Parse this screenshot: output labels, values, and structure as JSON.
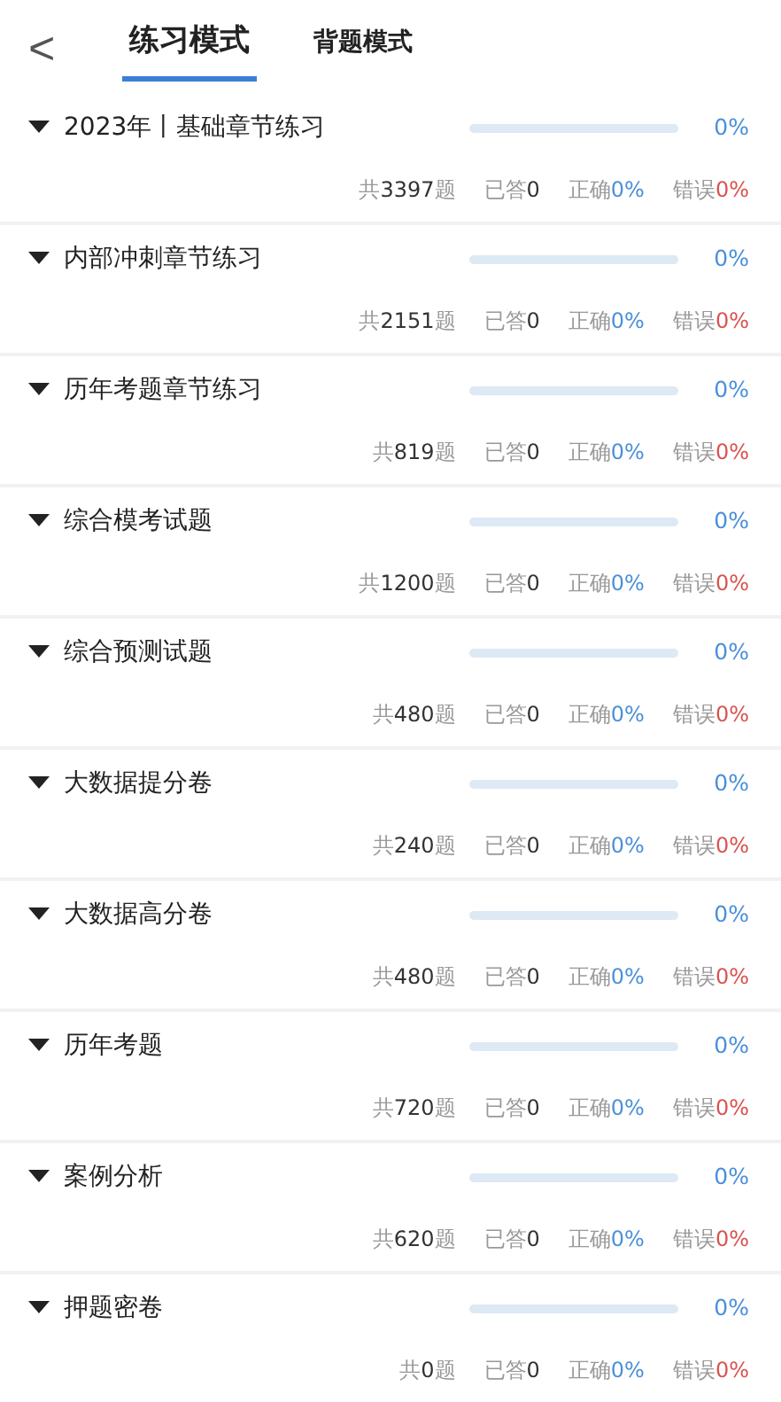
{
  "header": {
    "back": "<",
    "tabs": [
      {
        "label": "练习模式",
        "selected": true
      },
      {
        "label": "背题模式",
        "selected": false
      }
    ]
  },
  "sections": [
    {
      "title": "2023年丨基础章节练习",
      "expanded": true,
      "percent": "0%",
      "total": "共**3397**题",
      "answered": "已答**0**",
      "correct_label": "正确",
      "correct": "0%",
      "wrong_label": "错误",
      "wrong": "0%"
    },
    {
      "title": "内部冲刺章节练习",
      "expanded": true,
      "percent": "0%",
      "total": "共**2151**题",
      "answered": "已答**0**",
      "correct_label": "正确",
      "correct": "0%",
      "wrong_label": "错误",
      "wrong": "0%"
    },
    {
      "title": "历年考题章节练习",
      "expanded": true,
      "percent": "0%",
      "total": "共**819**题",
      "answered": "已答**0**",
      "correct_label": "正确",
      "correct": "0%",
      "wrong_label": "错误",
      "wrong": "0%"
    },
    {
      "title": "综合模考试题",
      "expanded": true,
      "percent": "0%",
      "total": "共**1200**题",
      "answered": "已答**0**",
      "correct_label": "正确",
      "correct": "0%",
      "wrong_label": "错误",
      "wrong": "0%"
    },
    {
      "title": "综合预测试题",
      "expanded": true,
      "percent": "0%",
      "total": "共**480**题",
      "answered": "已答**0**",
      "correct_label": "正确",
      "correct": "0%",
      "wrong_label": "错误",
      "wrong": "0%"
    },
    {
      "title": "大数据提分卷",
      "expanded": true,
      "percent": "0%",
      "total": "共**240**题",
      "answered": "已答**0**",
      "correct_label": "正确",
      "correct": "0%",
      "wrong_label": "错误",
      "wrong": "0%"
    },
    {
      "title": "大数据高分卷",
      "expanded": true,
      "percent": "0%",
      "total": "共**480**题",
      "answered": "已答**0**",
      "correct_label": "正确",
      "correct": "0%",
      "wrong_label": "错误",
      "wrong": "0%"
    },
    {
      "title": "历年考题",
      "expanded": true,
      "percent": "0%",
      "total": "共**720**题",
      "answered": "已答**0**",
      "correct_label": "正确",
      "correct": "0%",
      "wrong_label": "错误",
      "wrong": "0%"
    },
    {
      "title": "案例分析",
      "expanded": true,
      "percent": "0%",
      "total": "共**620**题",
      "answered": "已答**0**",
      "correct_label": "正确",
      "correct": "0%",
      "wrong_label": "错误",
      "wrong": "0%"
    },
    {
      "title": "押题密卷",
      "expanded": true,
      "percent": "0%",
      "total": "共**0**题",
      "answered": "已答**0**",
      "correct_label": "正确",
      "correct": "0%",
      "wrong_label": "错误",
      "wrong": "0%"
    }
  ]
}
